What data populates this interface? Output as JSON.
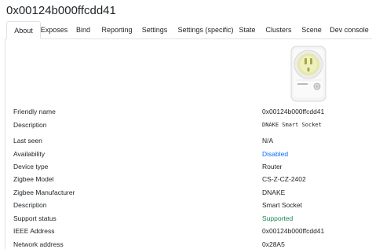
{
  "device": {
    "title": "0x00124b000ffcdd41"
  },
  "tabs": [
    {
      "label": "About",
      "active": true
    },
    {
      "label": "Exposes"
    },
    {
      "label": "Bind"
    },
    {
      "label": "Reporting"
    },
    {
      "label": "Settings"
    },
    {
      "label": "Settings (specific)"
    },
    {
      "label": "State"
    },
    {
      "label": "Clusters"
    },
    {
      "label": "Scene"
    },
    {
      "label": "Dev console"
    }
  ],
  "image": {
    "icon": "smart-socket-image",
    "colors": {
      "body": "#f2f2f2",
      "face": "#e6e8a8",
      "accent": "#c9cc6a"
    }
  },
  "details": [
    {
      "label": "Friendly name",
      "value": "0x00124b000ffcdd41"
    },
    {
      "label": "Description",
      "value": "DNAKE Smart Socket"
    },
    {
      "label": "Last seen",
      "value": "N/A"
    },
    {
      "label": "Availability",
      "value": "Disabled"
    },
    {
      "label": "Device type",
      "value": "Router"
    },
    {
      "label": "Zigbee Model",
      "value": "CS-Z-CZ-2402"
    },
    {
      "label": "Zigbee Manufacturer",
      "value": "DNAKE"
    },
    {
      "label": "Description",
      "value": "Smart Socket"
    },
    {
      "label": "Support status",
      "value": "Supported"
    },
    {
      "label": "IEEE Address",
      "value": "0x00124b000ffcdd41"
    },
    {
      "label": "Network address",
      "value": "0x28A5"
    }
  ],
  "colors": {
    "link": "#0d6efd",
    "success": "#198754",
    "border": "#dee2e6",
    "text": "#212529"
  }
}
